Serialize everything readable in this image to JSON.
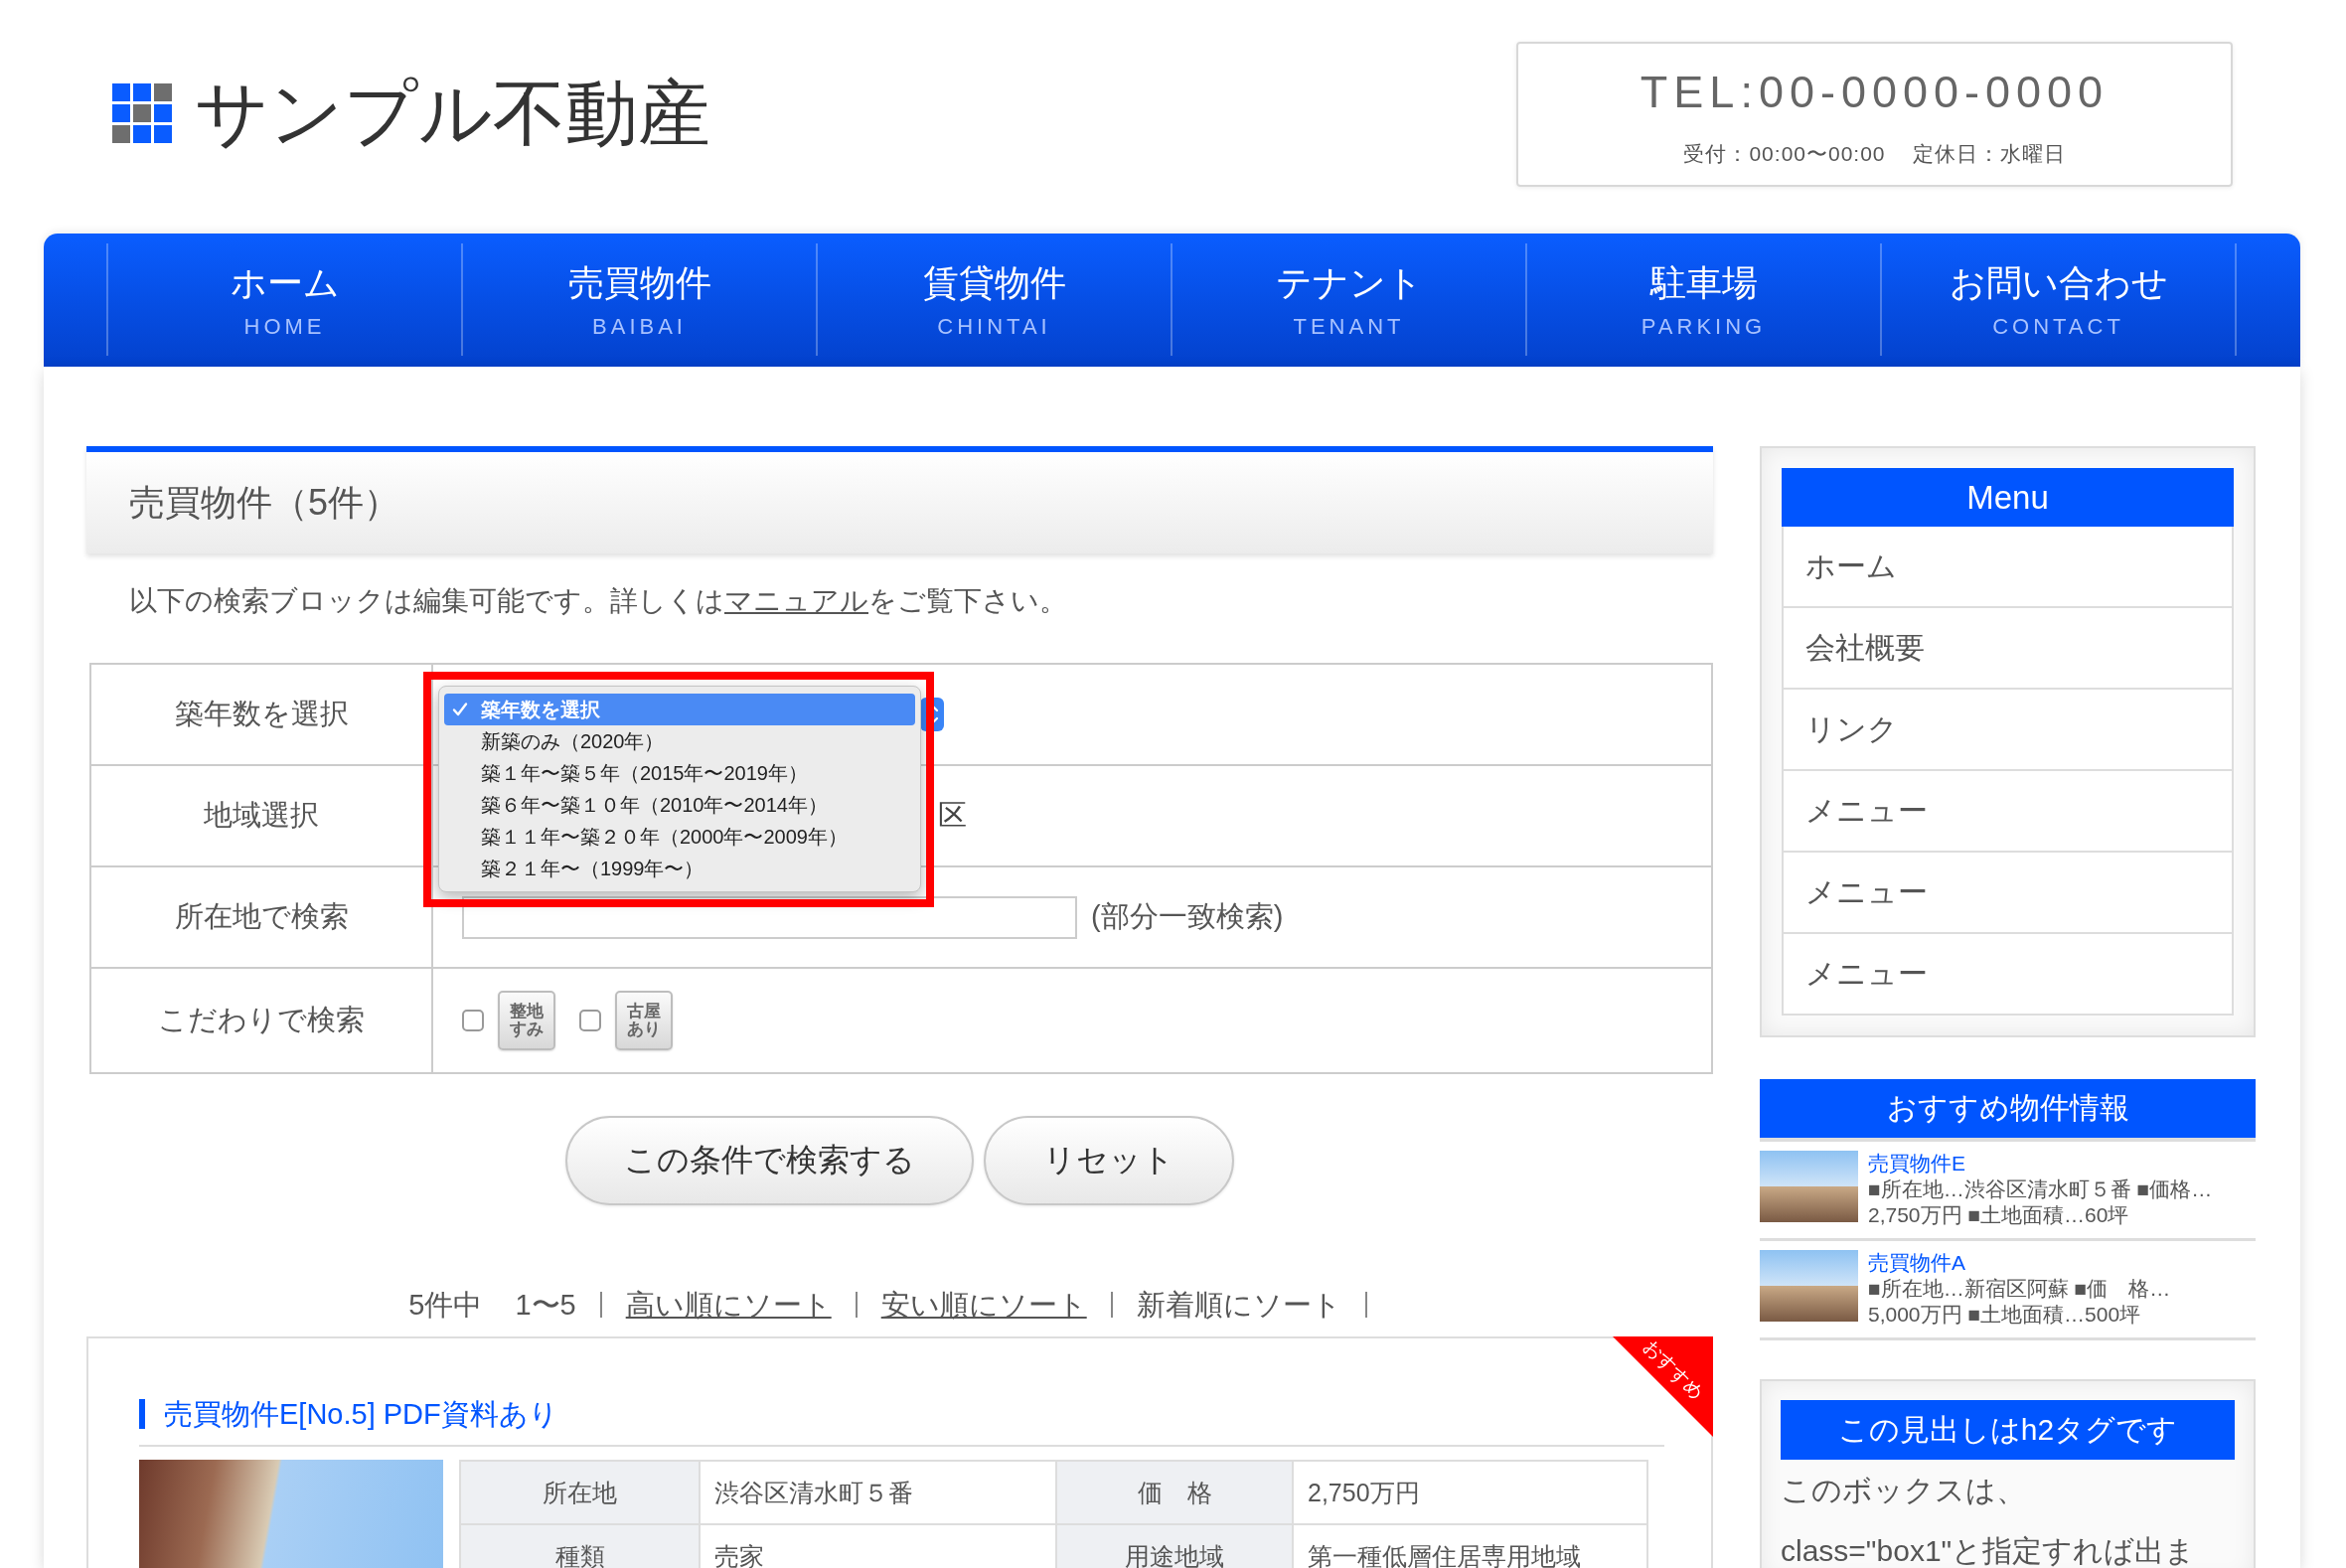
{
  "header": {
    "logo": "サンプル不動産",
    "phone": "TEL:00-0000-0000",
    "hours": [
      "受付：00:00〜00:00",
      "定休日：水曜日"
    ]
  },
  "nav": [
    {
      "label": "ホーム",
      "sub": "HOME"
    },
    {
      "label": "売買物件",
      "sub": "BAIBAI"
    },
    {
      "label": "賃貸物件",
      "sub": "CHINTAI"
    },
    {
      "label": "テナント",
      "sub": "TENANT"
    },
    {
      "label": "駐車場",
      "sub": "PARKING"
    },
    {
      "label": "お問い合わせ",
      "sub": "CONTACT"
    }
  ],
  "main": {
    "heading": "売買物件（5件）",
    "intro": {
      "text": "以下の検索ブロックは編集可能です。詳しくは",
      "link": "マニュアル",
      "after": "をご覧下さい。"
    },
    "search": {
      "rows": [
        {
          "kind": "select",
          "label": "築年数を選択",
          "dropdown": {
            "open": true,
            "highlighted": true,
            "options": [
              {
                "label": "築年数を選択",
                "selected": true
              },
              {
                "label": "新築のみ（2020年）",
                "selected": false
              },
              {
                "label": "築１年〜築５年（2015年〜2019年）",
                "selected": false
              },
              {
                "label": "築６年〜築１０年（2010年〜2014年）",
                "selected": false
              },
              {
                "label": "築１１年〜築２０年（2000年〜2009年）",
                "selected": false
              },
              {
                "label": "築２１年〜（1999年〜）",
                "selected": false
              }
            ]
          }
        },
        {
          "kind": "area",
          "label": "地域選択",
          "text": "区"
        },
        {
          "kind": "text",
          "label": "所在地で検索",
          "note": "(部分一致検索)"
        },
        {
          "kind": "tags",
          "label": "こだわりで検索",
          "options": [
            {
              "label": "整地すみ",
              "checked": false
            },
            {
              "label": "古屋あり",
              "checked": false
            }
          ]
        }
      ],
      "buttons": [
        {
          "kind": "submit",
          "label": "この条件で検索する"
        },
        {
          "kind": "reset",
          "label": "リセット"
        }
      ]
    },
    "pager": {
      "count": "5件中",
      "range": "1〜5",
      "sorts": [
        {
          "label": "高い順にソート",
          "selected": false
        },
        {
          "label": "安い順にソート",
          "selected": false
        },
        {
          "label": "新着順にソート",
          "selected": true
        }
      ]
    },
    "listing": {
      "badge": "おすすめ",
      "title": "売買物件E[No.5] PDF資料あり",
      "specs": [
        [
          {
            "label": "所在地",
            "value": "渋谷区清水町５番"
          },
          {
            "label": "価　格",
            "value": "2,750万円"
          }
        ],
        [
          {
            "label": "種類",
            "value": "売家"
          },
          {
            "label": "用途地域",
            "value": "第一種低層住居専用地域"
          }
        ]
      ]
    }
  },
  "sidebar": {
    "menu": {
      "title": "Menu",
      "items": [
        "ホーム",
        "会社概要",
        "リンク",
        "メニュー",
        "メニュー",
        "メニュー"
      ]
    },
    "featured": {
      "title": "おすすめ物件情報",
      "items": [
        {
          "name": "売買物件E",
          "details": "■所在地…渋谷区清水町５番 ■価格…2,750万円 ■土地面積…60坪"
        },
        {
          "name": "売買物件A",
          "details": "■所在地…新宿区阿蘇 ■価　格…5,000万円 ■土地面積…500坪"
        }
      ]
    },
    "box": {
      "title": "この見出しはh2タグです",
      "lines": [
        "このボックスは、",
        "class=\"box1\"と指定すれば出ま"
      ]
    }
  }
}
